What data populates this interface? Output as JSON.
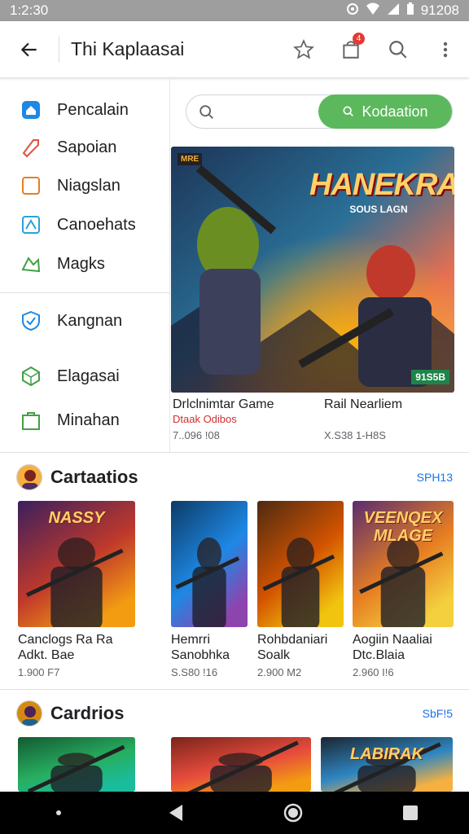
{
  "status_bar": {
    "time": "1:2:30",
    "right": "91208"
  },
  "app_bar": {
    "title": "Thi Kaplaasai",
    "cart_badge": "4"
  },
  "sidebar": {
    "items": [
      {
        "label": "Pencalain",
        "icon": "home-icon"
      },
      {
        "label": "Sapoian",
        "icon": "tag-icon"
      },
      {
        "label": "Niagslan",
        "icon": "square-icon"
      },
      {
        "label": "Canoehats",
        "icon": "map-icon"
      },
      {
        "label": "Magks",
        "icon": "shapes-icon"
      },
      {
        "label": "Kangnan",
        "icon": "shield-icon"
      },
      {
        "label": "Elagasai",
        "icon": "cube-icon"
      },
      {
        "label": "Minahan",
        "icon": "bag-icon"
      }
    ]
  },
  "search": {
    "placeholder": "",
    "button_label": "Kodaation"
  },
  "hero": {
    "banner_small": "MRE",
    "banner_title": "HANEKRAN",
    "banner_sub": "SOUS LAGN",
    "corner_tag": "91S5B",
    "left_title": "Drlclnimtar Game",
    "left_sub": "Dtaak Odibos",
    "left_meta": "7..096 !08",
    "right_title": "Rail Nearliem",
    "right_meta": "X.S38 1-H8S"
  },
  "section1": {
    "title": "Cartaatios",
    "more": "SPH13",
    "cards": [
      {
        "art": "NASSY",
        "title1": "Canclogs Ra Ra",
        "title2": "Adkt. Bae",
        "meta": "1.900 F7",
        "colors": [
          "#3b1f5e",
          "#c0392b",
          "#f39c12"
        ]
      },
      {
        "art": "",
        "title1": "Hemrri",
        "title2": "Sanobhka",
        "meta": "S.S80 !16",
        "colors": [
          "#0d3b66",
          "#1e88e5",
          "#8e44ad"
        ]
      },
      {
        "art": "",
        "title1": "Rohbdaniari",
        "title2": "Soalk",
        "meta": "2.900 M2",
        "colors": [
          "#4e2a12",
          "#d35400",
          "#f1c40f"
        ]
      },
      {
        "art": "VEENQEX MLAGE",
        "title1": "Aogiin Naaliai",
        "title2": "Dtc.Blaia",
        "meta": "2.960 I!6",
        "colors": [
          "#5b2c6f",
          "#e67e22",
          "#f4d03f"
        ]
      }
    ]
  },
  "section2": {
    "title": "Cardrios",
    "more": "SbF!5",
    "cards": [
      {
        "art": "",
        "colors": [
          "#145a32",
          "#27ae60",
          "#1abc9c"
        ]
      },
      {
        "art": "",
        "colors": [
          "#7b241c",
          "#e74c3c",
          "#f39c12"
        ]
      },
      {
        "art": "LABIRAK",
        "colors": [
          "#1b2631",
          "#2e86c1",
          "#f5b041"
        ]
      }
    ]
  },
  "colors": {
    "accent": "#5cb85c",
    "link": "#1a73e8",
    "status_bar": "#9e9e9e"
  }
}
